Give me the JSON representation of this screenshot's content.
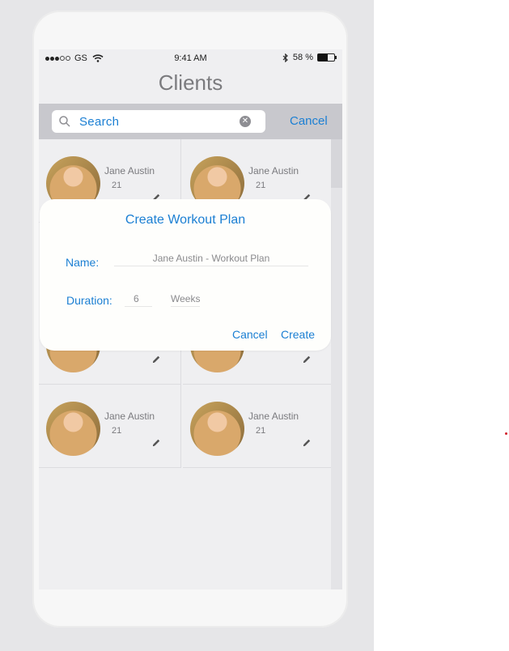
{
  "status_bar": {
    "carrier": "GS",
    "time": "9:41 AM",
    "battery": "58 %",
    "battery_level": 0.58
  },
  "nav": {
    "title": "Clients"
  },
  "search": {
    "placeholder": "Search",
    "cancel_label": "Cancel"
  },
  "clients": [
    {
      "name": "Jane Austin",
      "age": "21"
    },
    {
      "name": "Jane Austin",
      "age": "21"
    },
    {
      "name": "Jane Austin",
      "age": "21"
    },
    {
      "name": "Jane Austin",
      "age": "21"
    },
    {
      "name": "Jane Austin",
      "age": "21"
    },
    {
      "name": "Jane Austin",
      "age": "21"
    },
    {
      "name": "Jane Austin",
      "age": "21"
    },
    {
      "name": "Jane Austin",
      "age": "21"
    }
  ],
  "dialog": {
    "title": "Create Workout Plan",
    "name_label": "Name:",
    "name_value": "Jane Austin - Workout Plan",
    "duration_label": "Duration:",
    "duration_value": "6",
    "duration_unit": "Weeks",
    "cancel_label": "Cancel",
    "create_label": "Create"
  },
  "colors": {
    "accent": "#1b7fd3",
    "title_gray": "#7b7b7e",
    "searchbar": "#c8c8cd"
  }
}
